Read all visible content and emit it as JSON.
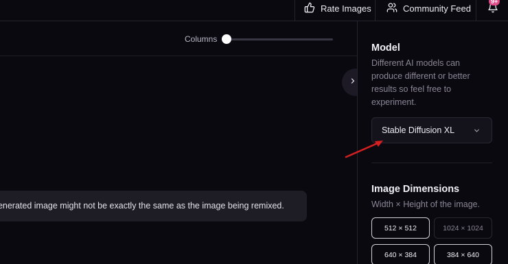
{
  "topbar": {
    "rate_label": "Rate Images",
    "community_label": "Community Feed",
    "notification_badge": "9+"
  },
  "toolbar": {
    "columns_label": "Columns",
    "columns_value": 0
  },
  "notice": {
    "text": "generated image might not be exactly the same as the image being remixed."
  },
  "sidebar": {
    "model": {
      "title": "Model",
      "description_lines": [
        "Different AI models can",
        "produce different or better",
        "results so feel free to",
        "experiment."
      ],
      "selected": "Stable Diffusion XL"
    },
    "dimensions": {
      "title": "Image Dimensions",
      "description": "Width × Height of the image.",
      "options": [
        "512 × 512",
        "1024 × 1024",
        "640 × 384",
        "384 × 640"
      ],
      "selected": "512 × 512"
    }
  },
  "colors": {
    "background": "#0b0910",
    "accent_badge": "#e14b8a",
    "annotation_arrow": "#d42020"
  }
}
